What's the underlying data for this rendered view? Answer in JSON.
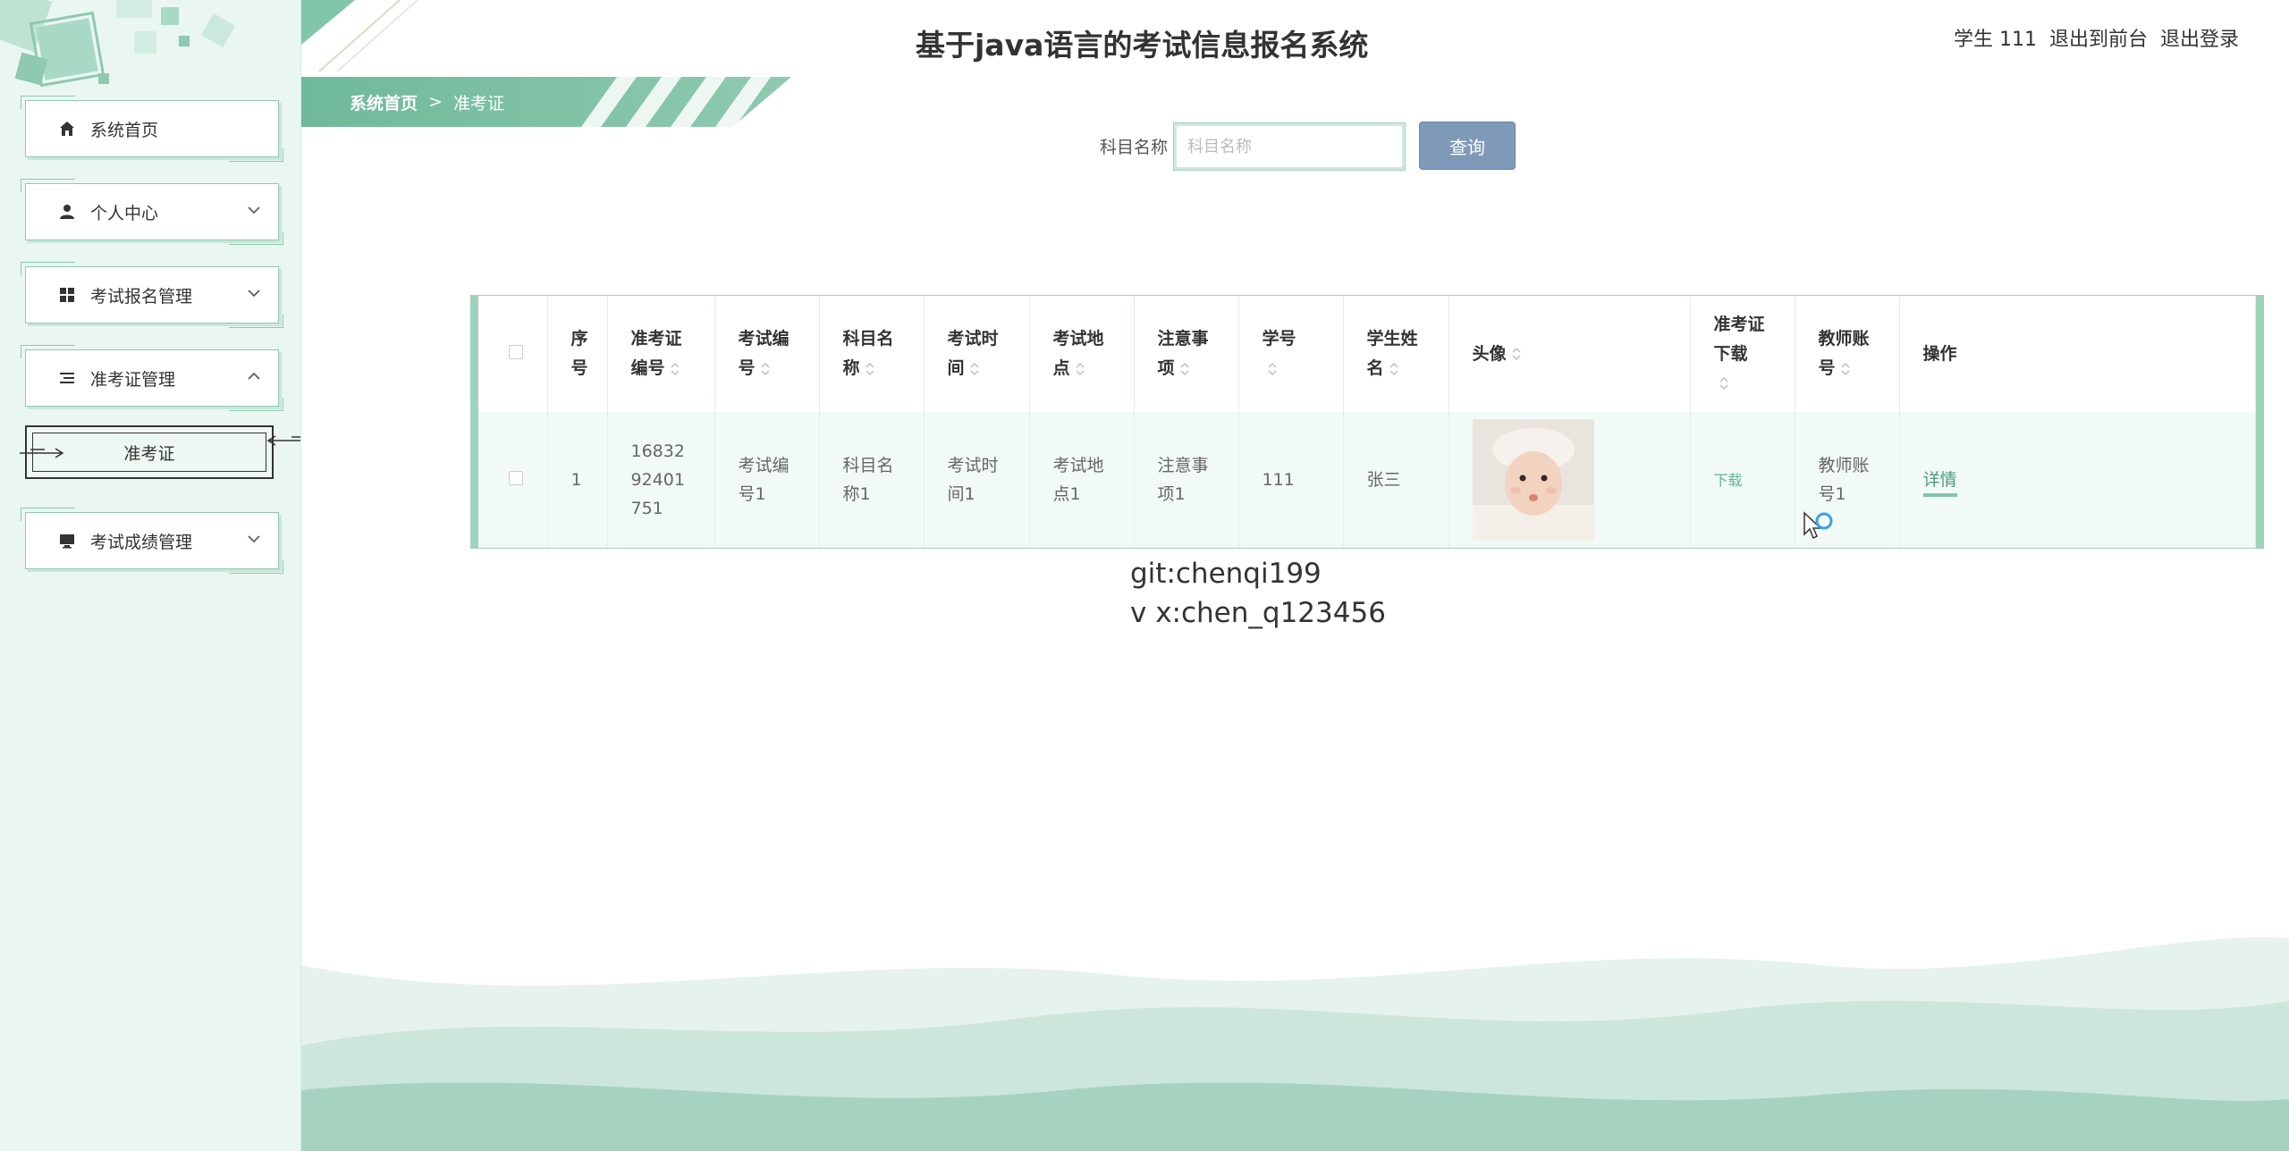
{
  "app": {
    "title": "基于java语言的考试信息报名系统"
  },
  "header": {
    "user": "学生 111",
    "back_front": "退出到前台",
    "logout": "退出登录"
  },
  "sidebar": {
    "items": [
      {
        "label": "系统首页",
        "icon": "home-icon"
      },
      {
        "label": "个人中心",
        "icon": "user-icon"
      },
      {
        "label": "考试报名管理",
        "icon": "grid-icon"
      },
      {
        "label": "准考证管理",
        "icon": "list-icon"
      },
      {
        "label": "考试成绩管理",
        "icon": "monitor-icon"
      }
    ],
    "sub_item": "准考证"
  },
  "breadcrumb": {
    "home": "系统首页",
    "separator": ">",
    "current": "准考证"
  },
  "search": {
    "label": "科目名称",
    "placeholder": "科目名称",
    "button": "查询"
  },
  "table": {
    "headers": {
      "index": "序号",
      "ticket_no": "准考证编号",
      "exam_no": "考试编号",
      "subject": "科目名称",
      "time": "考试时间",
      "place": "考试地点",
      "notes": "注意事项",
      "student_no": "学号",
      "student_name": "学生姓名",
      "avatar": "头像",
      "download": "准考证下载",
      "teacher": "教师账号",
      "ops": "操作"
    },
    "rows": [
      {
        "index": "1",
        "ticket_no": "1683292401751",
        "exam_no": "考试编号1",
        "subject": "科目名称1",
        "time": "考试时间1",
        "place": "考试地点1",
        "notes": "注意事项1",
        "student_no": "111",
        "student_name": "张三",
        "download": "下载",
        "teacher": "教师账号1",
        "ops": "详情"
      }
    ]
  },
  "watermark": {
    "line1": "git:chenqi199",
    "line2": "v x:chen_q123456"
  },
  "colors": {
    "accent": "#7fc7a8",
    "sidebar_bg": "#eaf6f1",
    "search_button": "#7f99b8"
  }
}
